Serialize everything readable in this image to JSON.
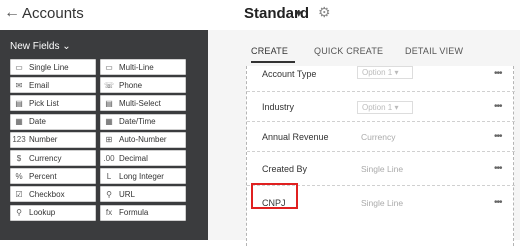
{
  "header": {
    "back_glyph": "←",
    "title": "Accounts",
    "layout": "Standard",
    "caret": "▾",
    "gear": "⚙"
  },
  "sidebar": {
    "heading": "New Fields ⌄",
    "fields": [
      {
        "icon": "▭",
        "icon_name": "single-line-icon",
        "label": "Single Line"
      },
      {
        "icon": "▭",
        "icon_name": "multi-line-icon",
        "label": "Multi-Line"
      },
      {
        "icon": "✉",
        "icon_name": "email-icon",
        "label": "Email"
      },
      {
        "icon": "☏",
        "icon_name": "phone-icon",
        "label": "Phone"
      },
      {
        "icon": "▤",
        "icon_name": "pick-list-icon",
        "label": "Pick List"
      },
      {
        "icon": "▤",
        "icon_name": "multi-select-icon",
        "label": "Multi-Select"
      },
      {
        "icon": "▦",
        "icon_name": "date-icon",
        "label": "Date"
      },
      {
        "icon": "▦",
        "icon_name": "date-time-icon",
        "label": "Date/Time"
      },
      {
        "icon": "123",
        "icon_name": "number-icon",
        "label": "Number"
      },
      {
        "icon": "⊞",
        "icon_name": "auto-number-icon",
        "label": "Auto-Number"
      },
      {
        "icon": "$",
        "icon_name": "currency-icon",
        "label": "Currency"
      },
      {
        "icon": ".00",
        "icon_name": "decimal-icon",
        "label": "Decimal"
      },
      {
        "icon": "%",
        "icon_name": "percent-icon",
        "label": "Percent"
      },
      {
        "icon": "L",
        "icon_name": "long-integer-icon",
        "label": "Long Integer"
      },
      {
        "icon": "☑",
        "icon_name": "checkbox-icon",
        "label": "Checkbox"
      },
      {
        "icon": "⚲",
        "icon_name": "url-icon",
        "label": "URL"
      },
      {
        "icon": "⚲",
        "icon_name": "lookup-icon",
        "label": "Lookup"
      },
      {
        "icon": "fx",
        "icon_name": "formula-icon",
        "label": "Formula"
      }
    ]
  },
  "tabs": [
    "CREATE",
    "QUICK CREATE",
    "DETAIL VIEW"
  ],
  "rows": [
    {
      "label": "Account Type",
      "value": "Option 1 ▾",
      "kind": "select",
      "more": "•••"
    },
    {
      "label": "Industry",
      "value": "Option 1 ▾",
      "kind": "select",
      "more": "•••"
    },
    {
      "label": "Annual Revenue",
      "value": "Currency",
      "kind": "text",
      "more": "•••"
    },
    {
      "label": "Created By",
      "value": "Single Line",
      "kind": "text",
      "more": "•••"
    },
    {
      "label": "CNPJ",
      "value": "Single Line",
      "kind": "text",
      "more": "•••"
    }
  ],
  "colors": {
    "highlight": "#e02020",
    "sidebar": "#3b3c3e"
  }
}
